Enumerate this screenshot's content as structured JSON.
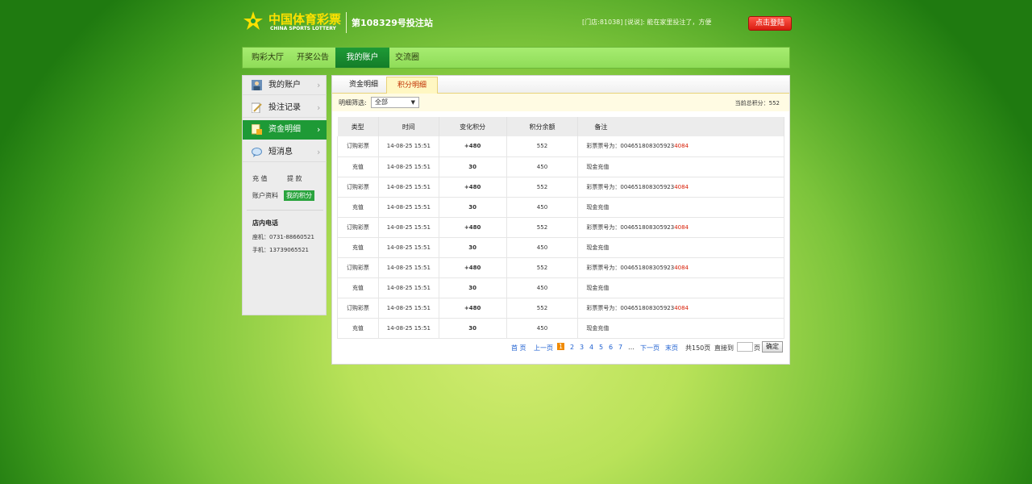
{
  "header": {
    "logo_cn": "中国体育彩票",
    "logo_en": "CHINA SPORTS LOTTERY",
    "station": "第108329号投注站",
    "notice": "[门店:81038] [说说]: 能在家里投注了，方便",
    "login_label": "点击登陆"
  },
  "nav": [
    "购彩大厅",
    "开奖公告",
    "我的账户",
    "交流圈"
  ],
  "sidebar": {
    "items": [
      {
        "label": "我的账户",
        "icon": "user-icon"
      },
      {
        "label": "投注记录",
        "icon": "edit-icon"
      },
      {
        "label": "资金明细",
        "icon": "ledger-icon"
      },
      {
        "label": "短消息",
        "icon": "message-icon"
      }
    ],
    "recharge": "充  值",
    "withdraw": "提  款",
    "profile": "账户资料",
    "my_points": "我的积分",
    "contact_title": "店内电话",
    "landline": "座机：0731-88660521",
    "mobile": "手机：13739065521"
  },
  "tabs": [
    "资金明细",
    "积分明细"
  ],
  "filter": {
    "label": "明细筛选:",
    "value": "全部",
    "total_points": "当前总积分：552"
  },
  "table": {
    "headers": [
      "类型",
      "时间",
      "变化积分",
      "积分余额",
      "备注"
    ],
    "rows": [
      {
        "type": "订购彩票",
        "time": "14-08-25 15:51",
        "change": "+480",
        "balance": "552",
        "note_prefix": "彩票票号为：004651808305923",
        "note_suffix": "4084"
      },
      {
        "type": "充值",
        "time": "14-08-25 15:51",
        "change": "30",
        "balance": "450",
        "note_prefix": "现金充值",
        "note_suffix": ""
      },
      {
        "type": "订购彩票",
        "time": "14-08-25 15:51",
        "change": "+480",
        "balance": "552",
        "note_prefix": "彩票票号为：004651808305923",
        "note_suffix": "4084"
      },
      {
        "type": "充值",
        "time": "14-08-25 15:51",
        "change": "30",
        "balance": "450",
        "note_prefix": "现金充值",
        "note_suffix": ""
      },
      {
        "type": "订购彩票",
        "time": "14-08-25 15:51",
        "change": "+480",
        "balance": "552",
        "note_prefix": "彩票票号为：004651808305923",
        "note_suffix": "4084"
      },
      {
        "type": "充值",
        "time": "14-08-25 15:51",
        "change": "30",
        "balance": "450",
        "note_prefix": "现金充值",
        "note_suffix": ""
      },
      {
        "type": "订购彩票",
        "time": "14-08-25 15:51",
        "change": "+480",
        "balance": "552",
        "note_prefix": "彩票票号为：004651808305923",
        "note_suffix": "4084"
      },
      {
        "type": "充值",
        "time": "14-08-25 15:51",
        "change": "30",
        "balance": "450",
        "note_prefix": "现金充值",
        "note_suffix": ""
      },
      {
        "type": "订购彩票",
        "time": "14-08-25 15:51",
        "change": "+480",
        "balance": "552",
        "note_prefix": "彩票票号为：004651808305923",
        "note_suffix": "4084"
      },
      {
        "type": "充值",
        "time": "14-08-25 15:51",
        "change": "30",
        "balance": "450",
        "note_prefix": "现金充值",
        "note_suffix": ""
      }
    ]
  },
  "pager": {
    "first": "首 页",
    "prev": "上一页",
    "pages": [
      "1",
      "2",
      "3",
      "4",
      "5",
      "6",
      "7"
    ],
    "ellipsis": "…",
    "next": "下一页",
    "last": "末页",
    "total": "共150页",
    "goto": "直接到",
    "page_unit": "页",
    "confirm": "确定"
  },
  "colors": {
    "brand_green": "#1e9a36",
    "accent_yellow": "#ffe100",
    "login_red": "#d91b10"
  }
}
